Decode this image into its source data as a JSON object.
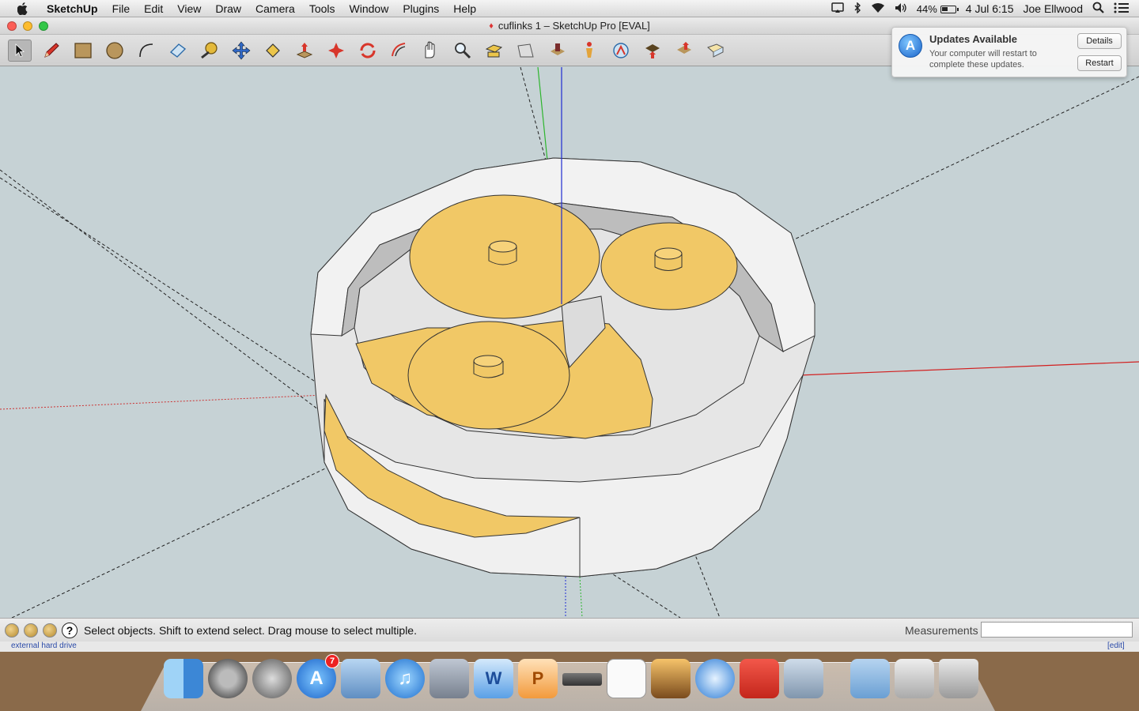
{
  "menubar": {
    "app": "SketchUp",
    "items": [
      "File",
      "Edit",
      "View",
      "Draw",
      "Camera",
      "Tools",
      "Window",
      "Plugins",
      "Help"
    ],
    "battery": "44%",
    "clock": "4 Jul  6:15",
    "user": "Joe Ellwood"
  },
  "window": {
    "title": "cuflinks 1 – SketchUp Pro [EVAL]"
  },
  "toolbar": {
    "tools": [
      "select-tool",
      "pencil-tool",
      "rectangle-tool",
      "circle-tool",
      "arc-tool",
      "eraser-tool",
      "tape-measure-tool",
      "move-tool",
      "paint-bucket-tool",
      "push-pull-tool",
      "rotate-tool",
      "follow-me-tool",
      "offset-tool",
      "orbit-tool",
      "pan-tool",
      "zoom-tool",
      "zoom-extents-tool",
      "previous-view-tool",
      "position-camera-tool",
      "look-around-tool",
      "walk-tool",
      "section-plane-tool",
      "add-location-tool",
      "toggle-terrain-tool",
      "photo-textures-tool",
      "share-model-tool",
      "get-models-tool"
    ]
  },
  "statusbar": {
    "hint": "Select objects. Shift to extend select. Drag mouse to select multiple.",
    "measurements_label": "Measurements",
    "measurements_value": ""
  },
  "bottom_strip": {
    "left": "external hard drive",
    "edit": "[edit]"
  },
  "notification": {
    "title": "Updates Available",
    "body": "Your computer will restart to complete these updates.",
    "details": "Details",
    "restart": "Restart"
  },
  "dock": {
    "apps": [
      "finder-icon",
      "system-preferences-icon",
      "launchpad-icon",
      "app-store-icon",
      "preview-icon",
      "itunes-icon",
      "facetime-icon",
      "word-icon",
      "powerpoint-icon",
      "device-icon",
      "reminders-icon",
      "iphoto-icon",
      "safari-icon",
      "sketchup-icon",
      "photo-booth-icon",
      "documents-folder-icon",
      "downloads-folder-icon",
      "trash-icon"
    ],
    "app_store_badge": "7"
  },
  "colors": {
    "model_face": "#f1c866",
    "model_wall": "#e9e9e9",
    "background": "#c6d2d5",
    "axis_red": "#d21f1f",
    "axis_green": "#2db52d",
    "axis_blue": "#1f2bd2"
  }
}
